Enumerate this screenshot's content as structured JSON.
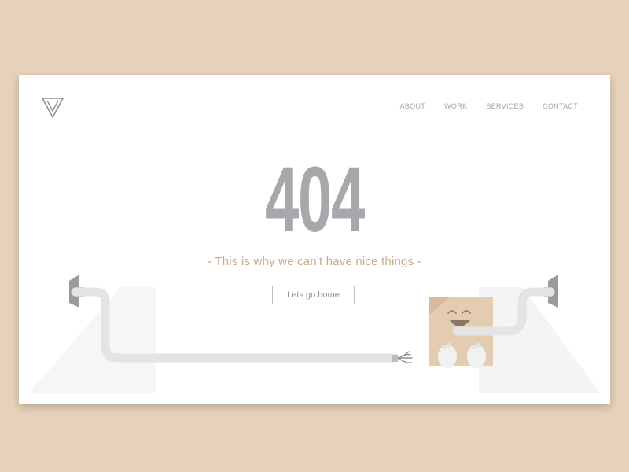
{
  "nav": {
    "items": [
      {
        "label": "ABOUT"
      },
      {
        "label": "WORK"
      },
      {
        "label": "SERVICES"
      },
      {
        "label": "CONTACT"
      }
    ]
  },
  "hero": {
    "code": "404",
    "tagline": "- This is why we can't have nice things -",
    "button_label": "Lets go home"
  },
  "icons": {
    "logo": "v-triangle-logo-icon",
    "left_socket": "wall-socket-icon",
    "right_socket": "wall-socket-icon",
    "frayed_cable": "broken-cable-end-icon",
    "mascot": "smiling-box-mascot-icon"
  },
  "colors": {
    "page_background": "#e6d2bb",
    "card_background": "#ffffff",
    "code_text": "#a7a8ab",
    "tagline_text": "#c9a88a",
    "nav_text": "#a5a5a5",
    "mascot_box": "#e4ccb1"
  }
}
